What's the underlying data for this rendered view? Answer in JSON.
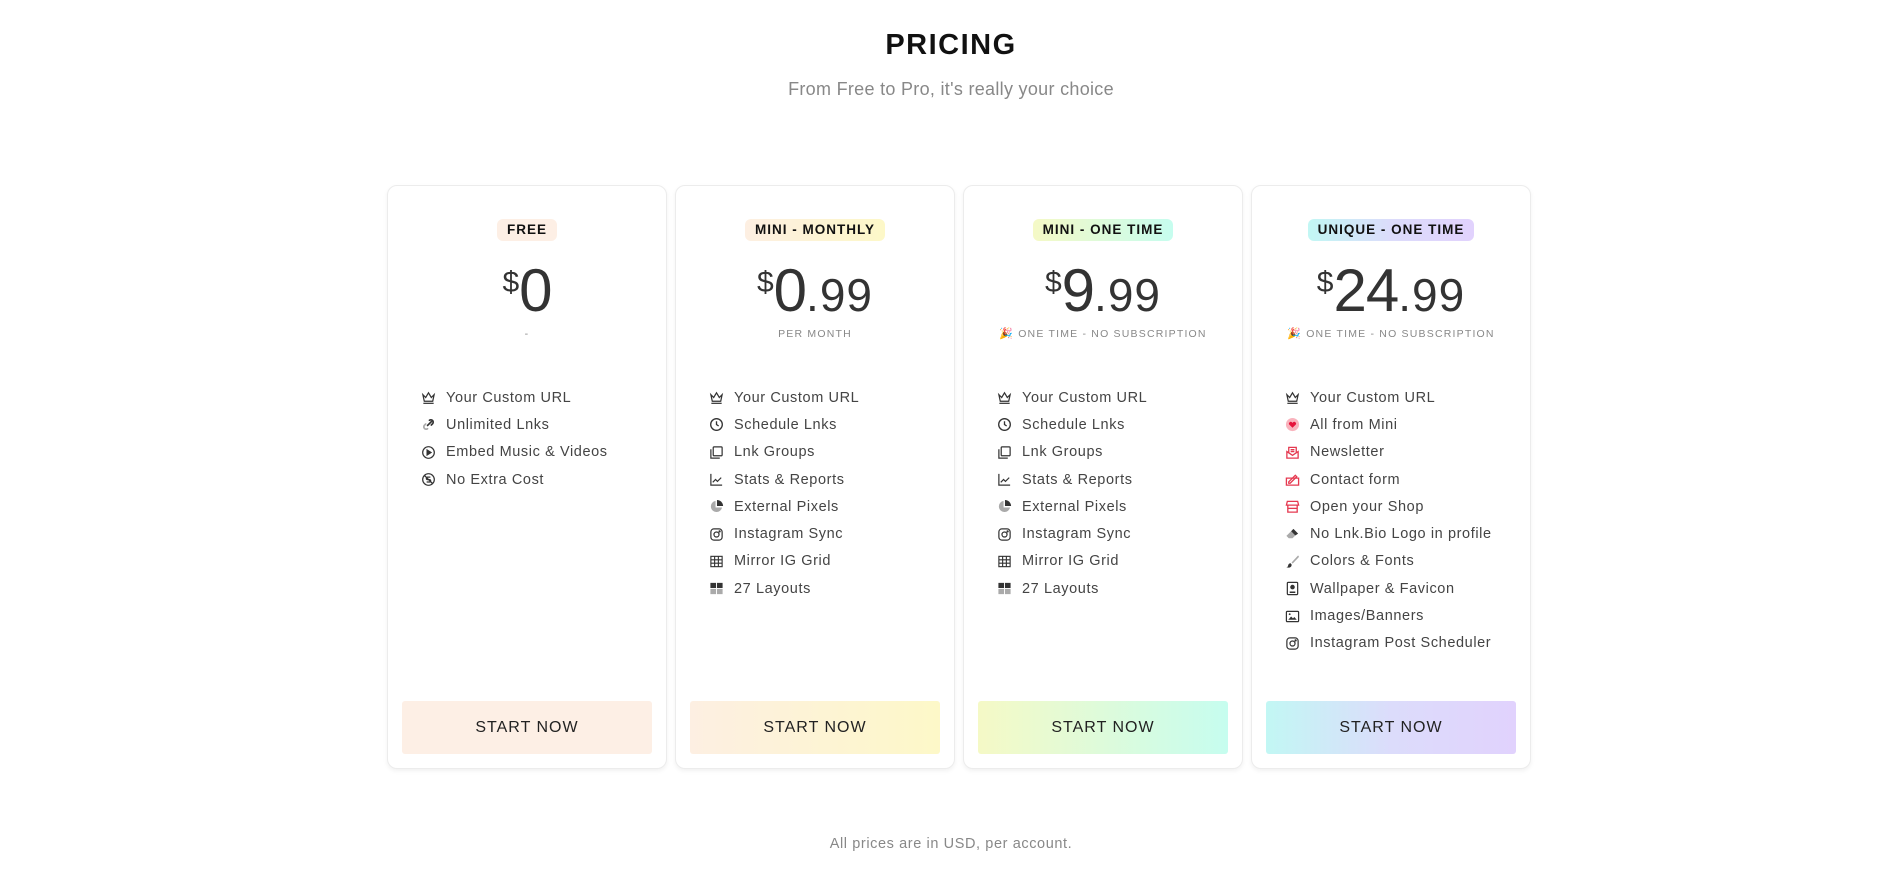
{
  "header": {
    "title": "PRICING",
    "subtitle": "From Free to Pro, it's really your choice"
  },
  "colors": {
    "free_badge": "#fdefe5",
    "monthly_gradient": [
      "#fdefe2",
      "#fdf8c8"
    ],
    "mini_one_time_gradient": [
      "#f5f9c6",
      "#c6fdef"
    ],
    "unique_gradient": [
      "#c2f7f4",
      "#e1d2fd"
    ],
    "accent_red": "#e53950",
    "text_muted": "#888888"
  },
  "plans": [
    {
      "badge": "FREE",
      "currency": "$",
      "price_int": "0",
      "price_dec": "",
      "note_icon": "",
      "note": "-",
      "cta": "START NOW",
      "features": [
        {
          "icon": "crown-icon",
          "label": "Your Custom URL"
        },
        {
          "icon": "link-icon",
          "label": "Unlimited Lnks"
        },
        {
          "icon": "play-circle-icon",
          "label": "Embed Music & Videos"
        },
        {
          "icon": "no-money-icon",
          "label": "No Extra Cost"
        }
      ]
    },
    {
      "badge": "MINI - MONTHLY",
      "currency": "$",
      "price_int": "0",
      "price_dec": ".99",
      "note_icon": "",
      "note": "PER MONTH",
      "cta": "START NOW",
      "features": [
        {
          "icon": "crown-icon",
          "label": "Your Custom URL"
        },
        {
          "icon": "clock-icon",
          "label": "Schedule Lnks"
        },
        {
          "icon": "copy-icon",
          "label": "Lnk Groups"
        },
        {
          "icon": "chart-line-icon",
          "label": "Stats & Reports"
        },
        {
          "icon": "pie-chart-icon",
          "label": "External Pixels"
        },
        {
          "icon": "instagram-icon",
          "label": "Instagram Sync"
        },
        {
          "icon": "grid-icon",
          "label": "Mirror IG Grid"
        },
        {
          "icon": "layouts-icon",
          "label": "27 Layouts"
        }
      ]
    },
    {
      "badge": "MINI - ONE TIME",
      "currency": "$",
      "price_int": "9",
      "price_dec": ".99",
      "note_icon": "🎉",
      "note": "ONE TIME - NO SUBSCRIPTION",
      "cta": "START NOW",
      "features": [
        {
          "icon": "crown-icon",
          "label": "Your Custom URL"
        },
        {
          "icon": "clock-icon",
          "label": "Schedule Lnks"
        },
        {
          "icon": "copy-icon",
          "label": "Lnk Groups"
        },
        {
          "icon": "chart-line-icon",
          "label": "Stats & Reports"
        },
        {
          "icon": "pie-chart-icon",
          "label": "External Pixels"
        },
        {
          "icon": "instagram-icon",
          "label": "Instagram Sync"
        },
        {
          "icon": "grid-icon",
          "label": "Mirror IG Grid"
        },
        {
          "icon": "layouts-icon",
          "label": "27 Layouts"
        }
      ]
    },
    {
      "badge": "UNIQUE - ONE TIME",
      "currency": "$",
      "price_int": "24",
      "price_dec": ".99",
      "note_icon": "🎉",
      "note": "ONE TIME - NO SUBSCRIPTION",
      "cta": "START NOW",
      "features": [
        {
          "icon": "crown-icon",
          "label": "Your Custom URL"
        },
        {
          "icon": "heart-icon",
          "label": "All from Mini"
        },
        {
          "icon": "newsletter-icon",
          "label": "Newsletter"
        },
        {
          "icon": "contact-form-icon",
          "label": "Contact form"
        },
        {
          "icon": "shop-icon",
          "label": "Open your Shop"
        },
        {
          "icon": "eraser-icon",
          "label": "No Lnk.Bio Logo in profile"
        },
        {
          "icon": "paintbrush-icon",
          "label": "Colors & Fonts"
        },
        {
          "icon": "portrait-icon",
          "label": "Wallpaper & Favicon"
        },
        {
          "icon": "image-icon",
          "label": "Images/Banners"
        },
        {
          "icon": "instagram-icon",
          "label": "Instagram Post Scheduler"
        }
      ]
    }
  ],
  "footer": {
    "note": "All prices are in USD, per account."
  }
}
